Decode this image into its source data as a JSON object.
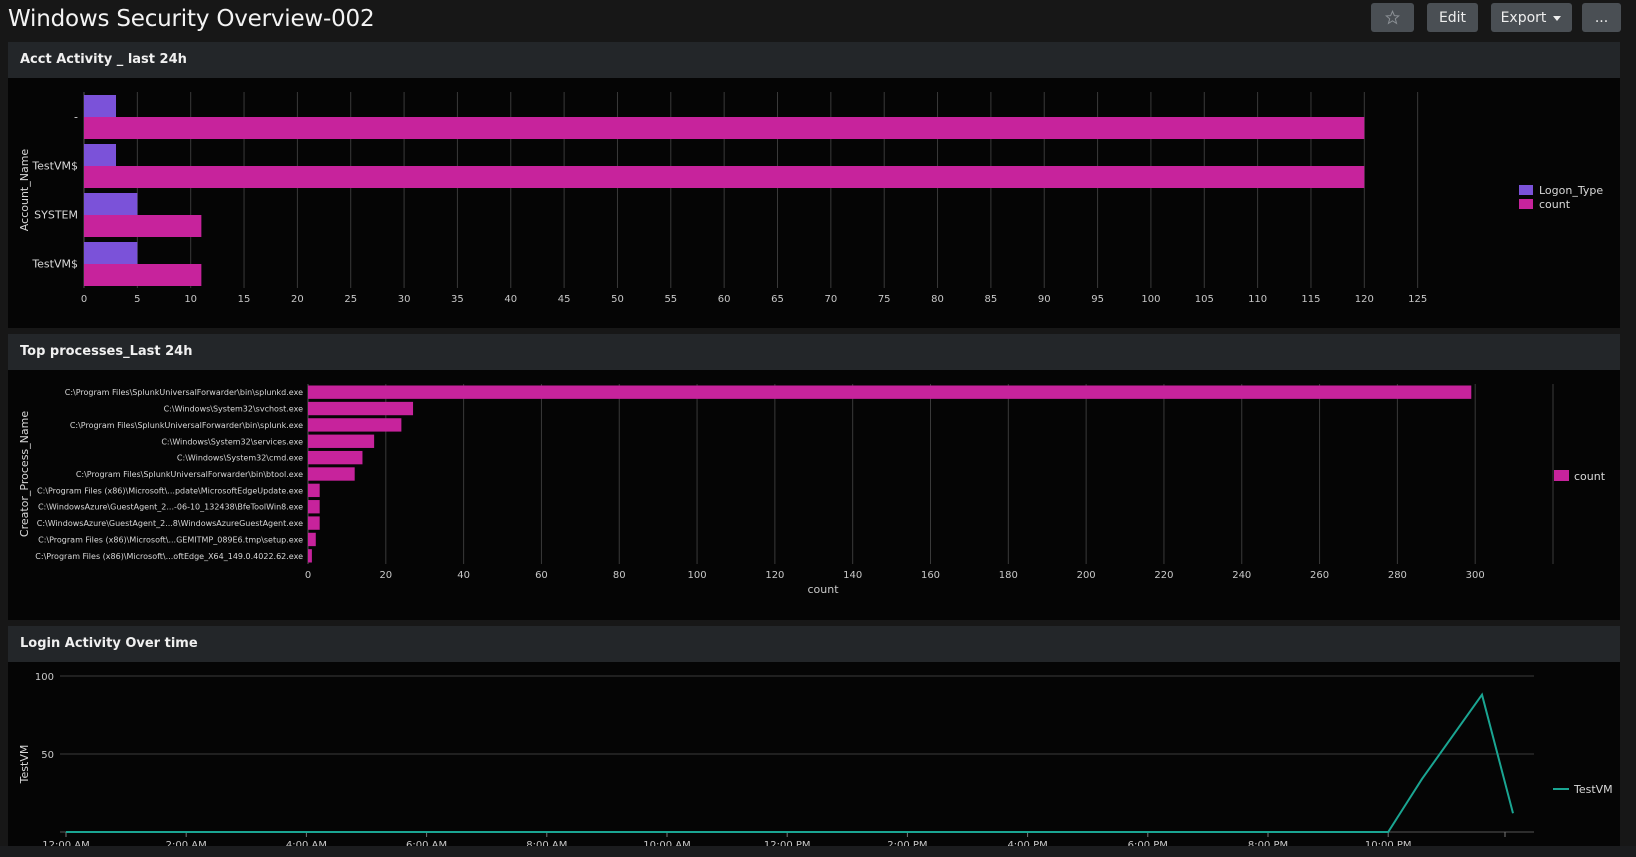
{
  "header": {
    "title": "Windows Security Overview-002",
    "favorite_icon": "star-icon",
    "edit_label": "Edit",
    "export_label": "Export",
    "export_icon": "caret-down-icon",
    "more_label": "..."
  },
  "colors": {
    "page_bg": "#171717",
    "panel_bg": "#050505",
    "panel_header_bg": "#232629",
    "series_pink": "#c7239c",
    "series_purple": "#7b52d9",
    "series_teal": "#1aa592"
  },
  "panels": [
    {
      "title": "Acct Activity _ last 24h"
    },
    {
      "title": "Top processes_Last 24h"
    },
    {
      "title": "Login Activity Over time"
    }
  ],
  "chart_data": [
    {
      "type": "bar",
      "orientation": "horizontal",
      "title": "Acct Activity _ last 24h",
      "ylabel": "Account_Name",
      "xlabel": "",
      "categories": [
        "-",
        "TestVM$",
        "SYSTEM",
        "TestVM$"
      ],
      "series": [
        {
          "name": "Logon_Type",
          "color": "#7b52d9",
          "values": [
            3,
            3,
            5,
            5
          ]
        },
        {
          "name": "count",
          "color": "#c7239c",
          "values": [
            120,
            120,
            11,
            11
          ]
        }
      ],
      "xlim": [
        0,
        130
      ],
      "xticks": [
        0,
        5,
        10,
        15,
        20,
        25,
        30,
        35,
        40,
        45,
        50,
        55,
        60,
        65,
        70,
        75,
        80,
        85,
        90,
        95,
        100,
        105,
        110,
        115,
        120,
        125
      ],
      "grid": true,
      "legend": "right"
    },
    {
      "type": "bar",
      "orientation": "horizontal",
      "title": "Top processes_Last 24h",
      "ylabel": "Creator_Process_Name",
      "xlabel": "count",
      "categories": [
        "C:\\Program Files\\SplunkUniversalForwarder\\bin\\splunkd.exe",
        "C:\\Windows\\System32\\svchost.exe",
        "C:\\Program Files\\SplunkUniversalForwarder\\bin\\splunk.exe",
        "C:\\Windows\\System32\\services.exe",
        "C:\\Windows\\System32\\cmd.exe",
        "C:\\Program Files\\SplunkUniversalForwarder\\bin\\btool.exe",
        "C:\\Program Files (x86)\\Microsoft\\...pdate\\MicrosoftEdgeUpdate.exe",
        "C:\\WindowsAzure\\GuestAgent_2...-06-10_132438\\BfeToolWin8.exe",
        "C:\\WindowsAzure\\GuestAgent_2...8\\WindowsAzureGuestAgent.exe",
        "C:\\Program Files (x86)\\Microsoft\\...GEMITMP_089E6.tmp\\setup.exe",
        "C:\\Program Files (x86)\\Microsoft\\...oftEdge_X64_149.0.4022.62.exe"
      ],
      "series": [
        {
          "name": "count",
          "color": "#c7239c",
          "values": [
            299,
            27,
            24,
            17,
            14,
            12,
            3,
            3,
            3,
            2,
            1
          ]
        }
      ],
      "xlim": [
        0,
        320
      ],
      "xticks": [
        0,
        20,
        40,
        60,
        80,
        100,
        120,
        140,
        160,
        180,
        200,
        220,
        240,
        260,
        280,
        300
      ],
      "grid": true,
      "legend": "right"
    },
    {
      "type": "line",
      "title": "Login Activity Over time",
      "ylabel": "TestVM",
      "xlabel": "",
      "x": [
        "12:00 AM",
        "2:00 AM",
        "4:00 AM",
        "6:00 AM",
        "8:00 AM",
        "10:00 AM",
        "12:00 PM",
        "2:00 PM",
        "4:00 PM",
        "6:00 PM",
        "8:00 PM",
        "10:00 PM",
        "11:00 PM",
        "12:00 AM",
        "1:00 AM"
      ],
      "xticks": [
        "12:00 AM",
        "2:00 AM",
        "4:00 AM",
        "6:00 AM",
        "8:00 AM",
        "10:00 AM",
        "12:00 PM",
        "2:00 PM",
        "4:00 PM",
        "6:00 PM",
        "8:00 PM",
        "10:00 PM"
      ],
      "series": [
        {
          "name": "TestVM",
          "color": "#1aa592",
          "values": [
            0,
            0,
            0,
            0,
            0,
            0,
            0,
            0,
            0,
            0,
            0,
            0,
            34,
            88,
            12
          ]
        }
      ],
      "ylim": [
        0,
        100
      ],
      "yticks": [
        50,
        100
      ],
      "grid": true,
      "legend": "right"
    }
  ]
}
